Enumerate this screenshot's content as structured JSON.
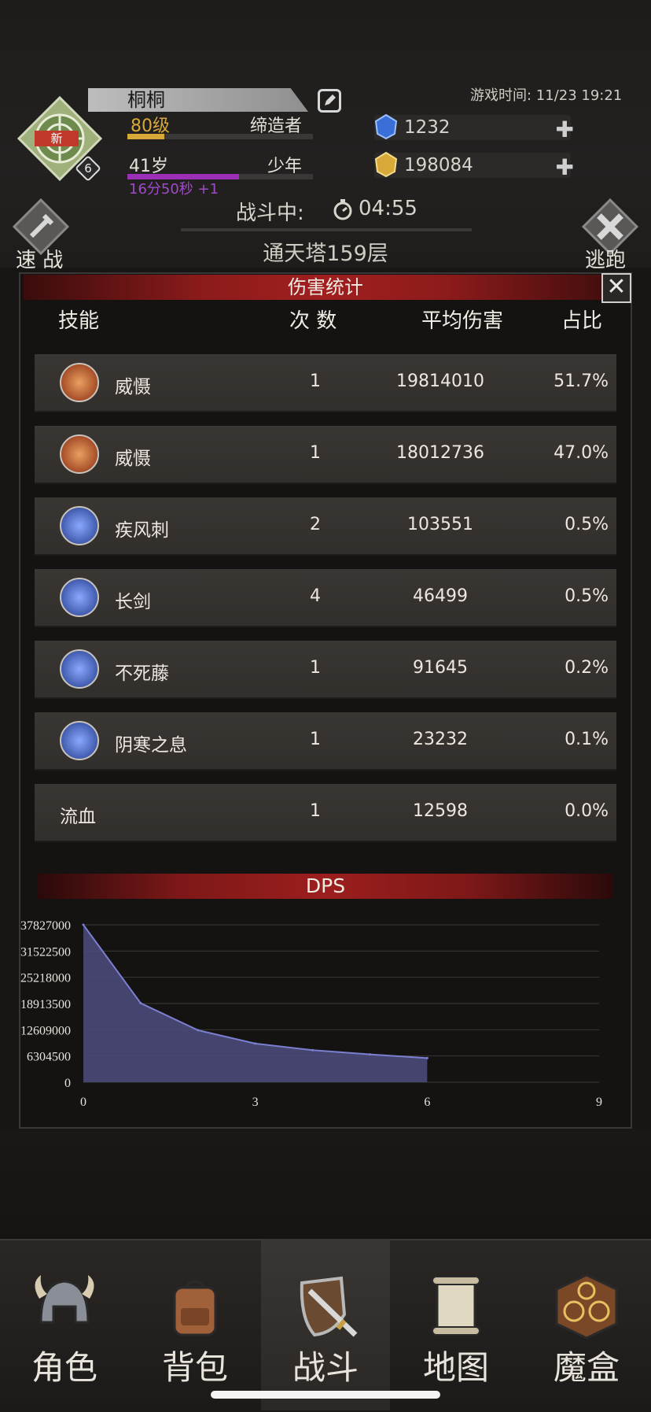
{
  "player": {
    "name": "桐桐",
    "level": "80级",
    "title": "缔造者",
    "age": "41岁",
    "age_stage": "少年",
    "timer": "16分50秒 +1",
    "portrait_badge": "新",
    "portrait_level": "6",
    "level_progress": 0.2,
    "age_progress": 0.6
  },
  "game_time": "游戏时间: 11/23 19:21",
  "resources": {
    "gems": "1232",
    "gold": "198084"
  },
  "battle": {
    "status": "战斗中:",
    "countdown": "04:55",
    "floor": "通天塔159层"
  },
  "side_buttons": {
    "left": "速 战",
    "right": "逃跑"
  },
  "panel": {
    "title": "伤害统计",
    "close": "✕",
    "headers": [
      "技能",
      "次 数",
      "平均伤害",
      "占比"
    ],
    "rows": [
      {
        "skill": "威慑",
        "count": "1",
        "avg": "19814010",
        "pct": "51.7%",
        "icon": "fire-icon"
      },
      {
        "skill": "威慑",
        "count": "1",
        "avg": "18012736",
        "pct": "47.0%",
        "icon": "fire-icon"
      },
      {
        "skill": "疾风刺",
        "count": "2",
        "avg": "103551",
        "pct": "0.5%",
        "icon": "triple-arrow-icon"
      },
      {
        "skill": "长剑",
        "count": "4",
        "avg": "46499",
        "pct": "0.5%",
        "icon": "sword-icon"
      },
      {
        "skill": "不死藤",
        "count": "1",
        "avg": "91645",
        "pct": "0.2%",
        "icon": "vine-icon"
      },
      {
        "skill": "阴寒之息",
        "count": "1",
        "avg": "23232",
        "pct": "0.1%",
        "icon": "frost-breath-icon"
      },
      {
        "skill": "流血",
        "count": "1",
        "avg": "12598",
        "pct": "0.0%",
        "icon": ""
      }
    ]
  },
  "colors": {
    "accent_red": "#9c1e1e",
    "area_fill": "#4a4a7a",
    "area_line": "#7b7fd0",
    "gem_blue": "#3a6fd8",
    "gold": "#d8a838"
  },
  "chart_data": {
    "type": "area",
    "title": "DPS",
    "x": [
      0,
      1,
      2,
      3,
      4,
      5,
      6
    ],
    "series": [
      {
        "values": [
          37827000,
          19000000,
          12500000,
          9300000,
          7700000,
          6700000,
          5800000
        ]
      }
    ],
    "xticks": [
      "0",
      "3",
      "6",
      "9"
    ],
    "yticks": [
      "37827000",
      "31522500",
      "25218000",
      "18913500",
      "12609000",
      "6304500",
      "0"
    ],
    "xlim": [
      0,
      9
    ],
    "ylim": [
      0,
      37827000
    ],
    "grid": true
  },
  "nav": [
    {
      "label": "角色",
      "icon": "helmet-icon"
    },
    {
      "label": "背包",
      "icon": "backpack-icon"
    },
    {
      "label": "战斗",
      "icon": "shield-sword-icon",
      "active": true
    },
    {
      "label": "地图",
      "icon": "scroll-map-icon"
    },
    {
      "label": "魔盒",
      "icon": "magic-box-icon"
    }
  ]
}
